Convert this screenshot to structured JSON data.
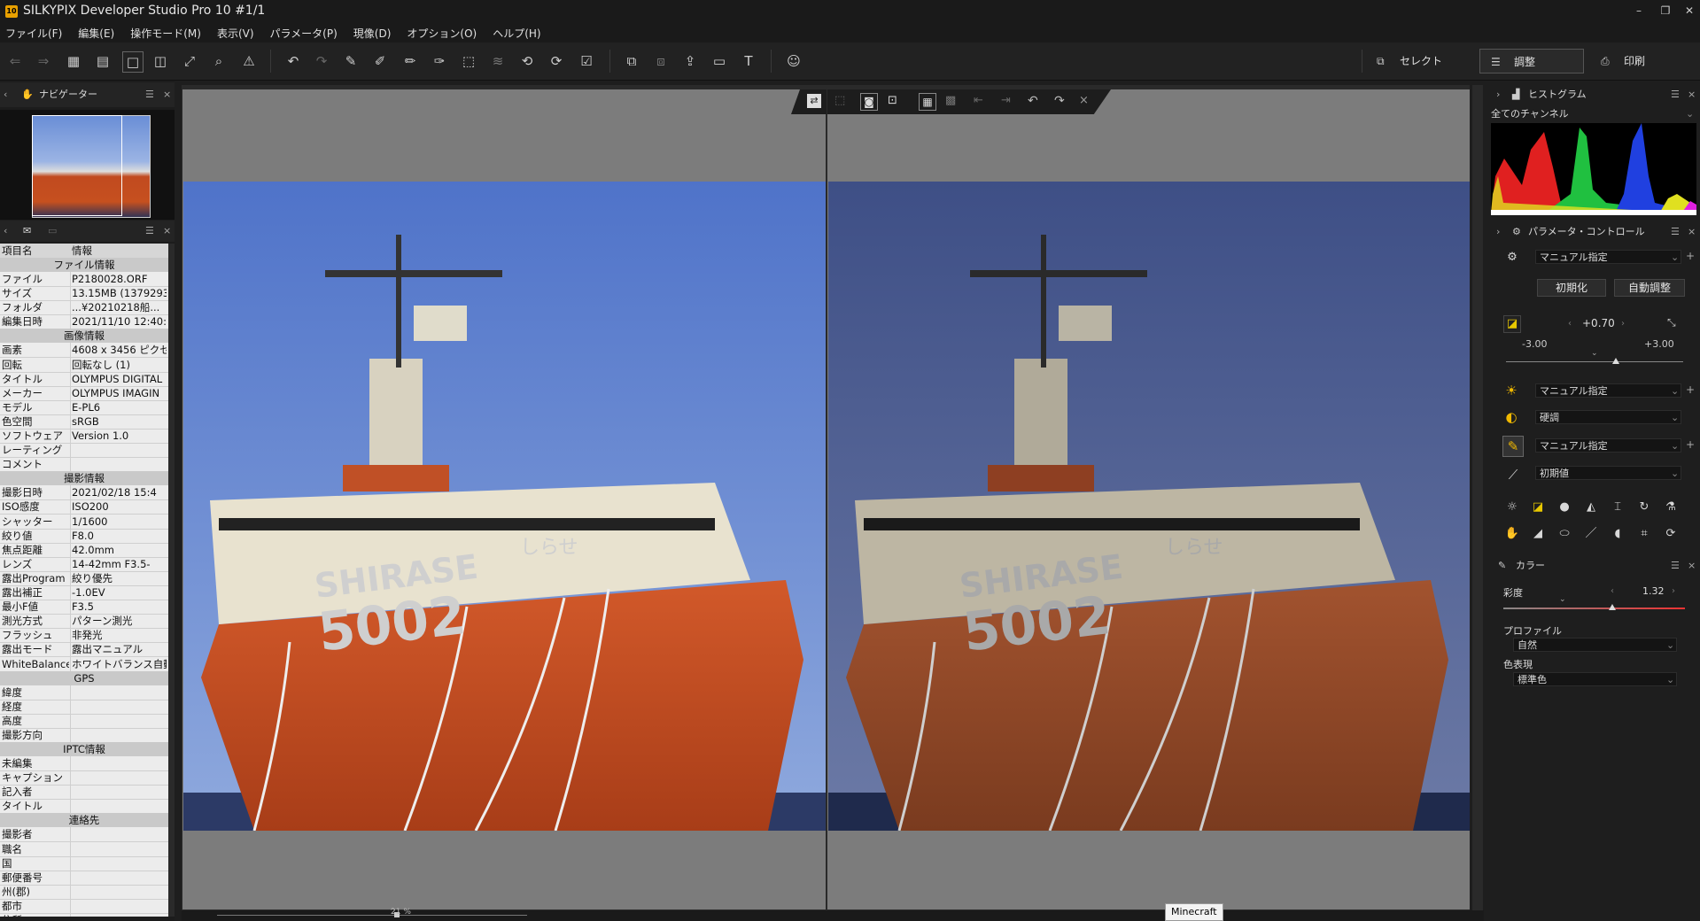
{
  "window": {
    "title": "SILKYPIX Developer Studio Pro 10   #1/1",
    "icon_label": "10",
    "minimize": "–",
    "maximize": "❐",
    "close": "✕"
  },
  "menu": [
    "ファイル(F)",
    "編集(E)",
    "操作モード(M)",
    "表示(V)",
    "パラメータ(P)",
    "現像(D)",
    "オプション(O)",
    "ヘルプ(H)"
  ],
  "modes": {
    "select": "セレクト",
    "adjust": "調整",
    "print": "印刷"
  },
  "navigator": {
    "title": "ナビゲーター"
  },
  "info": {
    "col_key": "項目名",
    "col_val": "情報",
    "sections": [
      {
        "title": "ファイル情報",
        "rows": [
          [
            "ファイル",
            "P2180028.ORF"
          ],
          [
            "サイズ",
            "13.15MB (1379293"
          ],
          [
            "フォルダ",
            "...¥20210218船..."
          ],
          [
            "編集日時",
            "2021/11/10 12:40:"
          ]
        ]
      },
      {
        "title": "画像情報",
        "rows": [
          [
            "画素",
            "4608 x 3456 ピクセル"
          ],
          [
            "回転",
            "回転なし (1)"
          ],
          [
            "タイトル",
            "OLYMPUS DIGITAL"
          ],
          [
            "メーカー",
            "OLYMPUS IMAGIN"
          ],
          [
            "モデル",
            "E-PL6"
          ],
          [
            "色空間",
            "sRGB"
          ],
          [
            "ソフトウェア",
            "Version 1.0"
          ],
          [
            "レーティング",
            ""
          ],
          [
            "コメント",
            ""
          ]
        ]
      },
      {
        "title": "撮影情報",
        "rows": [
          [
            "撮影日時",
            "2021/02/18 15:4"
          ],
          [
            "ISO感度",
            "ISO200"
          ],
          [
            "シャッター",
            "1/1600"
          ],
          [
            "絞り値",
            "F8.0"
          ],
          [
            "焦点距離",
            "42.0mm"
          ],
          [
            "レンズ",
            "14-42mm F3.5-"
          ],
          [
            "露出Program",
            "絞り優先"
          ],
          [
            "露出補正",
            "-1.0EV"
          ],
          [
            "最小F値",
            "F3.5"
          ],
          [
            "測光方式",
            "パターン測光"
          ],
          [
            "フラッシュ",
            "非発光"
          ],
          [
            "露出モード",
            "露出マニュアル"
          ],
          [
            "WhiteBalance",
            "ホワイトバランス自動"
          ]
        ]
      },
      {
        "title": "GPS",
        "rows": [
          [
            "緯度",
            ""
          ],
          [
            "経度",
            ""
          ],
          [
            "高度",
            ""
          ],
          [
            "撮影方向",
            ""
          ]
        ]
      },
      {
        "title": "IPTC情報",
        "rows": [
          [
            "未編集",
            ""
          ],
          [
            "キャプション",
            ""
          ],
          [
            "記入者",
            ""
          ],
          [
            "タイトル",
            ""
          ]
        ]
      },
      {
        "title": "連絡先",
        "rows": [
          [
            "撮影者",
            ""
          ],
          [
            "職名",
            ""
          ],
          [
            "国",
            ""
          ],
          [
            "郵便番号",
            ""
          ],
          [
            "州(郡)",
            ""
          ],
          [
            "都市",
            ""
          ],
          [
            "住所",
            ""
          ]
        ]
      }
    ]
  },
  "status": {
    "zoom": "21 %"
  },
  "histogram": {
    "title": "ヒストグラム",
    "channel": "全てのチャンネル"
  },
  "param_control": {
    "title": "パラメータ・コントロール",
    "preset": "マニュアル指定",
    "init_button": "初期化",
    "auto_button": "自動調整",
    "exposure_value": "+0.70",
    "exposure_min": "-3.00",
    "exposure_max": "+3.00",
    "exposure_level": 0.62,
    "wb": "マニュアル指定",
    "contrast": "硬調",
    "sharpness": "マニュアル指定",
    "tone": "初期値"
  },
  "color": {
    "title": "カラー",
    "saturation_label": "彩度",
    "saturation_value": "1.32",
    "saturation_level": 0.6,
    "profile_label": "プロファイル",
    "profile": "自然",
    "rendering_label": "色表現",
    "rendering": "標準色"
  },
  "tooltip": "Minecraft",
  "photo": {
    "ship_name": "SHIRASE",
    "ship_number": "5002",
    "ship_kana": "しらせ"
  }
}
